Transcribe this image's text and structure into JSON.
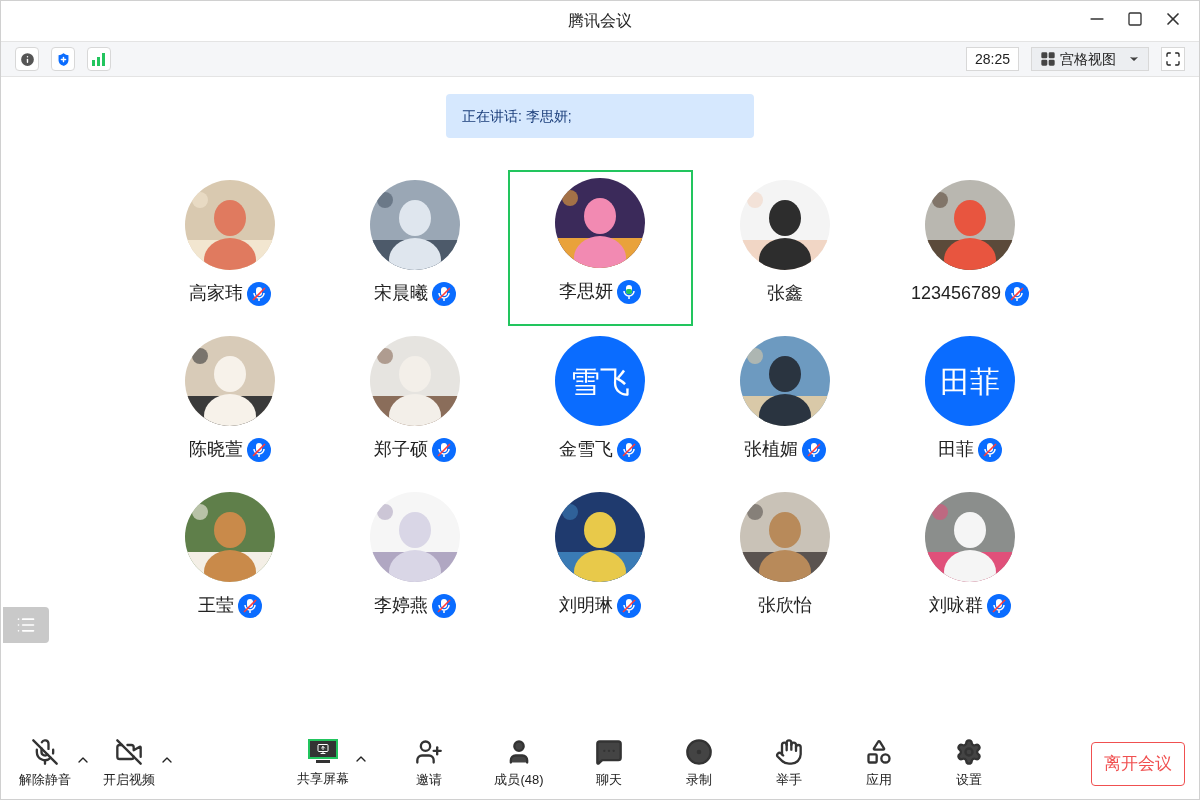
{
  "window": {
    "title": "腾讯会议"
  },
  "top_bar": {
    "timer": "28:25",
    "view_button": "宫格视图"
  },
  "speaking_banner": "正在讲话: 李思妍;",
  "participants": [
    {
      "name": "高家玮",
      "muted": true,
      "speaking": false,
      "selected": false
    },
    {
      "name": "宋晨曦",
      "muted": true,
      "speaking": false,
      "selected": false
    },
    {
      "name": "李思妍",
      "muted": false,
      "speaking": true,
      "selected": true
    },
    {
      "name": "张鑫",
      "muted": false,
      "speaking": false,
      "selected": false
    },
    {
      "name": "123456789",
      "muted": true,
      "speaking": false,
      "selected": false
    },
    {
      "name": "陈晓萱",
      "muted": true,
      "speaking": false,
      "selected": false
    },
    {
      "name": "郑子硕",
      "muted": true,
      "speaking": false,
      "selected": false
    },
    {
      "name": "金雪飞",
      "avatar": {
        "kind": "initials",
        "text": "雪飞"
      },
      "muted": true,
      "speaking": false,
      "selected": false
    },
    {
      "name": "张植媚",
      "muted": true,
      "speaking": false,
      "selected": false
    },
    {
      "name": "田菲",
      "avatar": {
        "kind": "initials",
        "text": "田菲"
      },
      "muted": true,
      "speaking": false,
      "selected": false
    },
    {
      "name": "王莹",
      "muted": true,
      "speaking": false,
      "selected": false
    },
    {
      "name": "李婷燕",
      "muted": true,
      "speaking": false,
      "selected": false
    },
    {
      "name": "刘明琳",
      "muted": true,
      "speaking": false,
      "selected": false
    },
    {
      "name": "张欣怡",
      "muted": false,
      "speaking": false,
      "selected": false
    },
    {
      "name": "刘咏群",
      "muted": true,
      "speaking": false,
      "selected": false
    }
  ],
  "toolbar": [
    {
      "kind": "mic_off",
      "label": "解除静音",
      "caret": true
    },
    {
      "kind": "video_off",
      "label": "开启视频",
      "caret": true
    },
    {
      "kind": "share",
      "label": "共享屏幕",
      "caret": true
    },
    {
      "kind": "invite",
      "label": "邀请",
      "caret": false
    },
    {
      "kind": "members",
      "label": "成员(48)",
      "caret": false
    },
    {
      "kind": "chat",
      "label": "聊天",
      "caret": false
    },
    {
      "kind": "record",
      "label": "录制",
      "caret": false
    },
    {
      "kind": "hand",
      "label": "举手",
      "caret": false
    },
    {
      "kind": "apps",
      "label": "应用",
      "caret": false
    },
    {
      "kind": "settings",
      "label": "设置",
      "caret": false
    }
  ],
  "leave_button": "离开会议"
}
